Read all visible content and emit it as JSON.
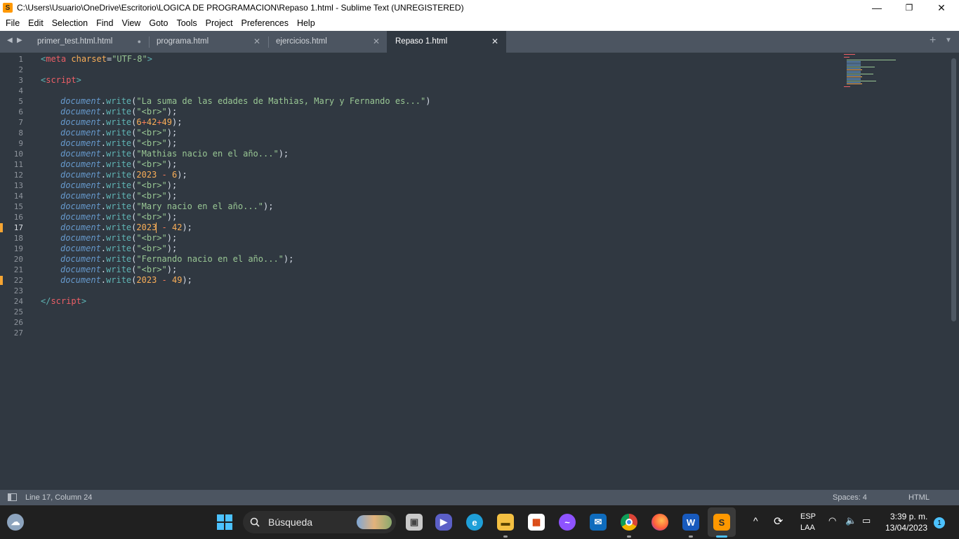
{
  "window": {
    "title": "C:\\Users\\Usuario\\OneDrive\\Escritorio\\LOGICA DE PROGRAMACION\\Repaso 1.html - Sublime Text (UNREGISTERED)",
    "minimize": "—",
    "maximize": "❐",
    "close": "✕"
  },
  "menu": [
    "File",
    "Edit",
    "Selection",
    "Find",
    "View",
    "Goto",
    "Tools",
    "Project",
    "Preferences",
    "Help"
  ],
  "tabs": [
    {
      "label": "primer_test.html.html",
      "close": "●",
      "active": false
    },
    {
      "label": "programa.html",
      "close": "✕",
      "active": false
    },
    {
      "label": "ejercicios.html",
      "close": "✕",
      "active": false
    },
    {
      "label": "Repaso 1.html",
      "close": "✕",
      "active": true
    }
  ],
  "editor": {
    "line_numbers": [
      "1",
      "2",
      "3",
      "4",
      "5",
      "6",
      "7",
      "8",
      "9",
      "10",
      "11",
      "12",
      "13",
      "14",
      "15",
      "16",
      "17",
      "18",
      "19",
      "20",
      "21",
      "22",
      "23",
      "24",
      "25",
      "26",
      "27"
    ],
    "active_line": "17",
    "modified_lines": [
      "17",
      "22"
    ],
    "code": {
      "meta_open": "<",
      "meta_tag": "meta",
      "meta_attr": "charset",
      "meta_eq": "=",
      "meta_value": "\"UTF-8\"",
      "meta_close": ">",
      "script_open_lt": "<",
      "script_tag": "script",
      "script_open_gt": ">",
      "script_close_lt": "</",
      "script_close_gt": ">",
      "obj": "document",
      "dot": ".",
      "fn": "write",
      "paren_open": "(",
      "paren_close_semi": ");",
      "paren_close": ")",
      "str_suma": "\"La suma de las edades de Mathias, Mary y Fernando es...\"",
      "str_br": "\"<br>\"",
      "num_6": "6",
      "plus": "+",
      "num_42": "42",
      "num_49": "49",
      "str_mathias": "\"Mathias nacio en el año...\"",
      "num_2023": "2023",
      "minus": " - ",
      "str_mary": "\"Mary nacio en el año...\"",
      "str_fernando": "\"Fernando nacio en el año...\""
    }
  },
  "status": {
    "position": "Line 17, Column 24",
    "spaces": "Spaces: 4",
    "syntax": "HTML"
  },
  "taskbar": {
    "search_label": "Búsqueda",
    "language_top": "ESP",
    "language_bottom": "LAA",
    "time": "3:39 p. m.",
    "date": "13/04/2023",
    "notification_count": "1"
  },
  "colors": {
    "editor_bg": "#303841",
    "tab_bar_bg": "#4c5561",
    "tag": "#ec5f66",
    "string": "#99c794",
    "number": "#f9ae58",
    "object": "#6699cc",
    "function": "#5fb4b4",
    "modified_marker": "#f6a532"
  }
}
